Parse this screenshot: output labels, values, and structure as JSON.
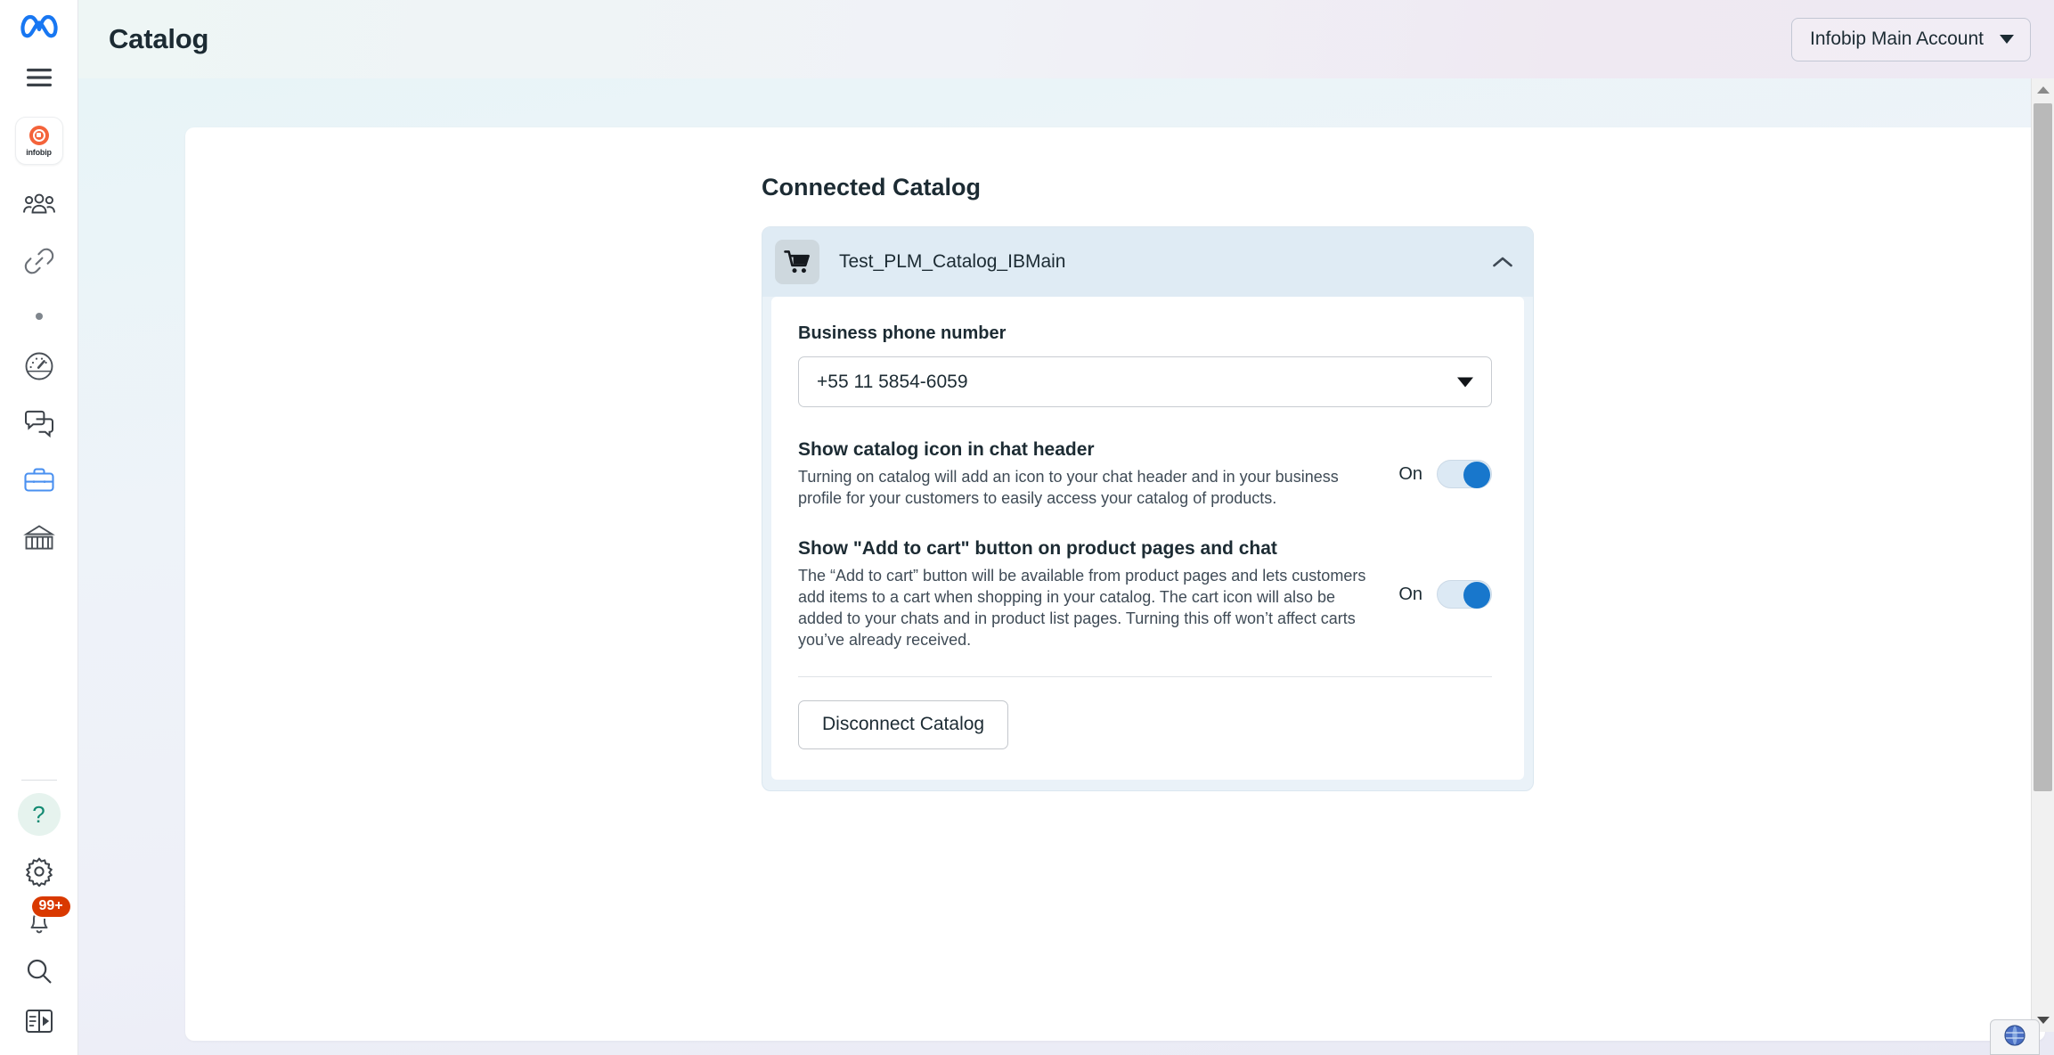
{
  "rail": {
    "meta_logo": "meta-logo",
    "items": [
      {
        "name": "hamburger-menu",
        "icon": "hamburger-icon"
      },
      {
        "name": "infobip-workspace",
        "icon": "infobip-logo-icon",
        "label": "infobip"
      },
      {
        "name": "audiences",
        "icon": "people-icon"
      },
      {
        "name": "links",
        "icon": "link-icon"
      },
      {
        "name": "more",
        "icon": "dot-icon"
      },
      {
        "name": "analytics",
        "icon": "speedometer-icon"
      },
      {
        "name": "chats",
        "icon": "chat-bubbles-icon"
      },
      {
        "name": "business-tools",
        "icon": "briefcase-icon",
        "active": true
      },
      {
        "name": "billing",
        "icon": "bank-icon"
      }
    ],
    "bottom_items": [
      {
        "name": "help",
        "icon": "question-mark-icon",
        "glyph": "?"
      },
      {
        "name": "settings",
        "icon": "gear-icon"
      },
      {
        "name": "notifications",
        "icon": "bell-icon",
        "badge": "99+"
      },
      {
        "name": "search",
        "icon": "search-icon"
      },
      {
        "name": "toggle-panel",
        "icon": "panel-toggle-icon"
      }
    ]
  },
  "topbar": {
    "title": "Catalog",
    "account_label": "Infobip Main Account"
  },
  "main": {
    "section_title": "Connected Catalog",
    "catalog": {
      "name": "Test_PLM_Catalog_IBMain",
      "icon": "shopping-cart-icon",
      "collapse_icon": "chevron-up-icon",
      "phone_field": {
        "label": "Business phone number",
        "value": "+55 11 5854-6059"
      },
      "settings": [
        {
          "heading": "Show catalog icon in chat header",
          "description": "Turning on catalog will add an icon to your chat header and in your business profile for your customers to easily access your catalog of products.",
          "toggle_label": "On",
          "toggle_state": "on"
        },
        {
          "heading": "Show \"Add to cart\" button on product pages and chat",
          "description": "The “Add to cart” button will be available from product pages and lets customers add items to a cart when shopping in your catalog. The cart icon will also be added to your chats and in product list pages. Turning this off won’t affect carts you’ve already received.",
          "toggle_label": "On",
          "toggle_state": "on"
        }
      ],
      "disconnect_label": "Disconnect Catalog"
    }
  },
  "scrollbar": {
    "up_arrow": "scroll-up-arrow",
    "down_arrow": "scroll-down-arrow"
  },
  "taskbar": {
    "globe": "globe-icon"
  },
  "colors": {
    "accent_blue": "#1877cc",
    "meta_blue": "#1877f2",
    "infobip_orange": "#f4633a",
    "badge_red": "#d93900",
    "help_teal": "#138a72"
  }
}
